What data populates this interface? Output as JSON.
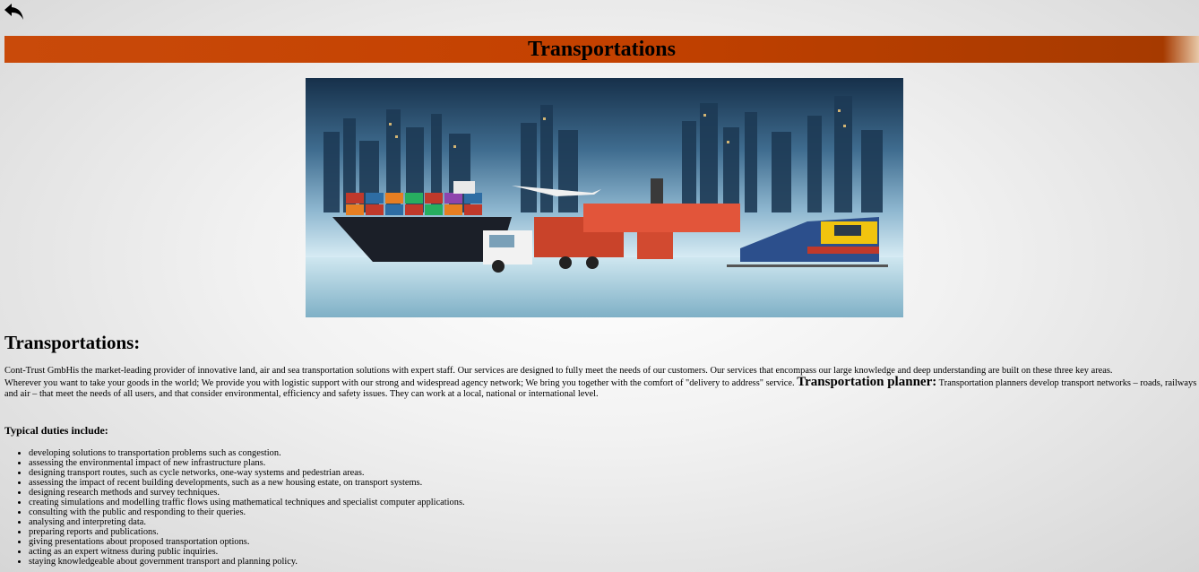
{
  "nav": {
    "back_icon": "back-arrow-icon"
  },
  "banner": {
    "title": "Transportations",
    "color": "#c44100"
  },
  "hero": {
    "icon": "logistics-collage-image"
  },
  "section": {
    "title": "Transportations:"
  },
  "intro": {
    "line1": "Cont-Trust GmbHis the market-leading provider of innovative land, air and sea transportation solutions with expert staff. Our services are designed to fully meet the needs of our customers. Our services that encompass our large knowledge and deep understanding are built on these three key areas.",
    "line2": "Wherever you want to take your goods in the world; We provide you with logistic support with our strong and widespread agency network; We bring you together with the comfort of \"delivery to address\" service.",
    "planner_label": "Transportation planner:",
    "planner_text": "Transportation planners develop transport networks – roads, railways and air – that meet the needs of all users, and that consider environmental, efficiency and safety issues. They can work at a local, national or international level."
  },
  "duties": {
    "title": "Typical duties include:",
    "items": [
      "developing solutions to transportation problems such as congestion.",
      "assessing the environmental impact of new infrastructure plans.",
      "designing transport routes, such as cycle networks, one-way systems and pedestrian areas.",
      "assessing the impact of recent building developments, such as a new housing estate, on transport systems.",
      "designing research methods and survey techniques.",
      "creating simulations and modelling traffic flows using mathematical techniques and specialist computer applications.",
      "consulting with the public and responding to their queries.",
      "analysing and interpreting data.",
      "preparing reports and publications.",
      "giving presentations about proposed transportation options.",
      "acting as an expert witness during public inquiries.",
      "staying knowledgeable about government transport and planning policy."
    ]
  }
}
